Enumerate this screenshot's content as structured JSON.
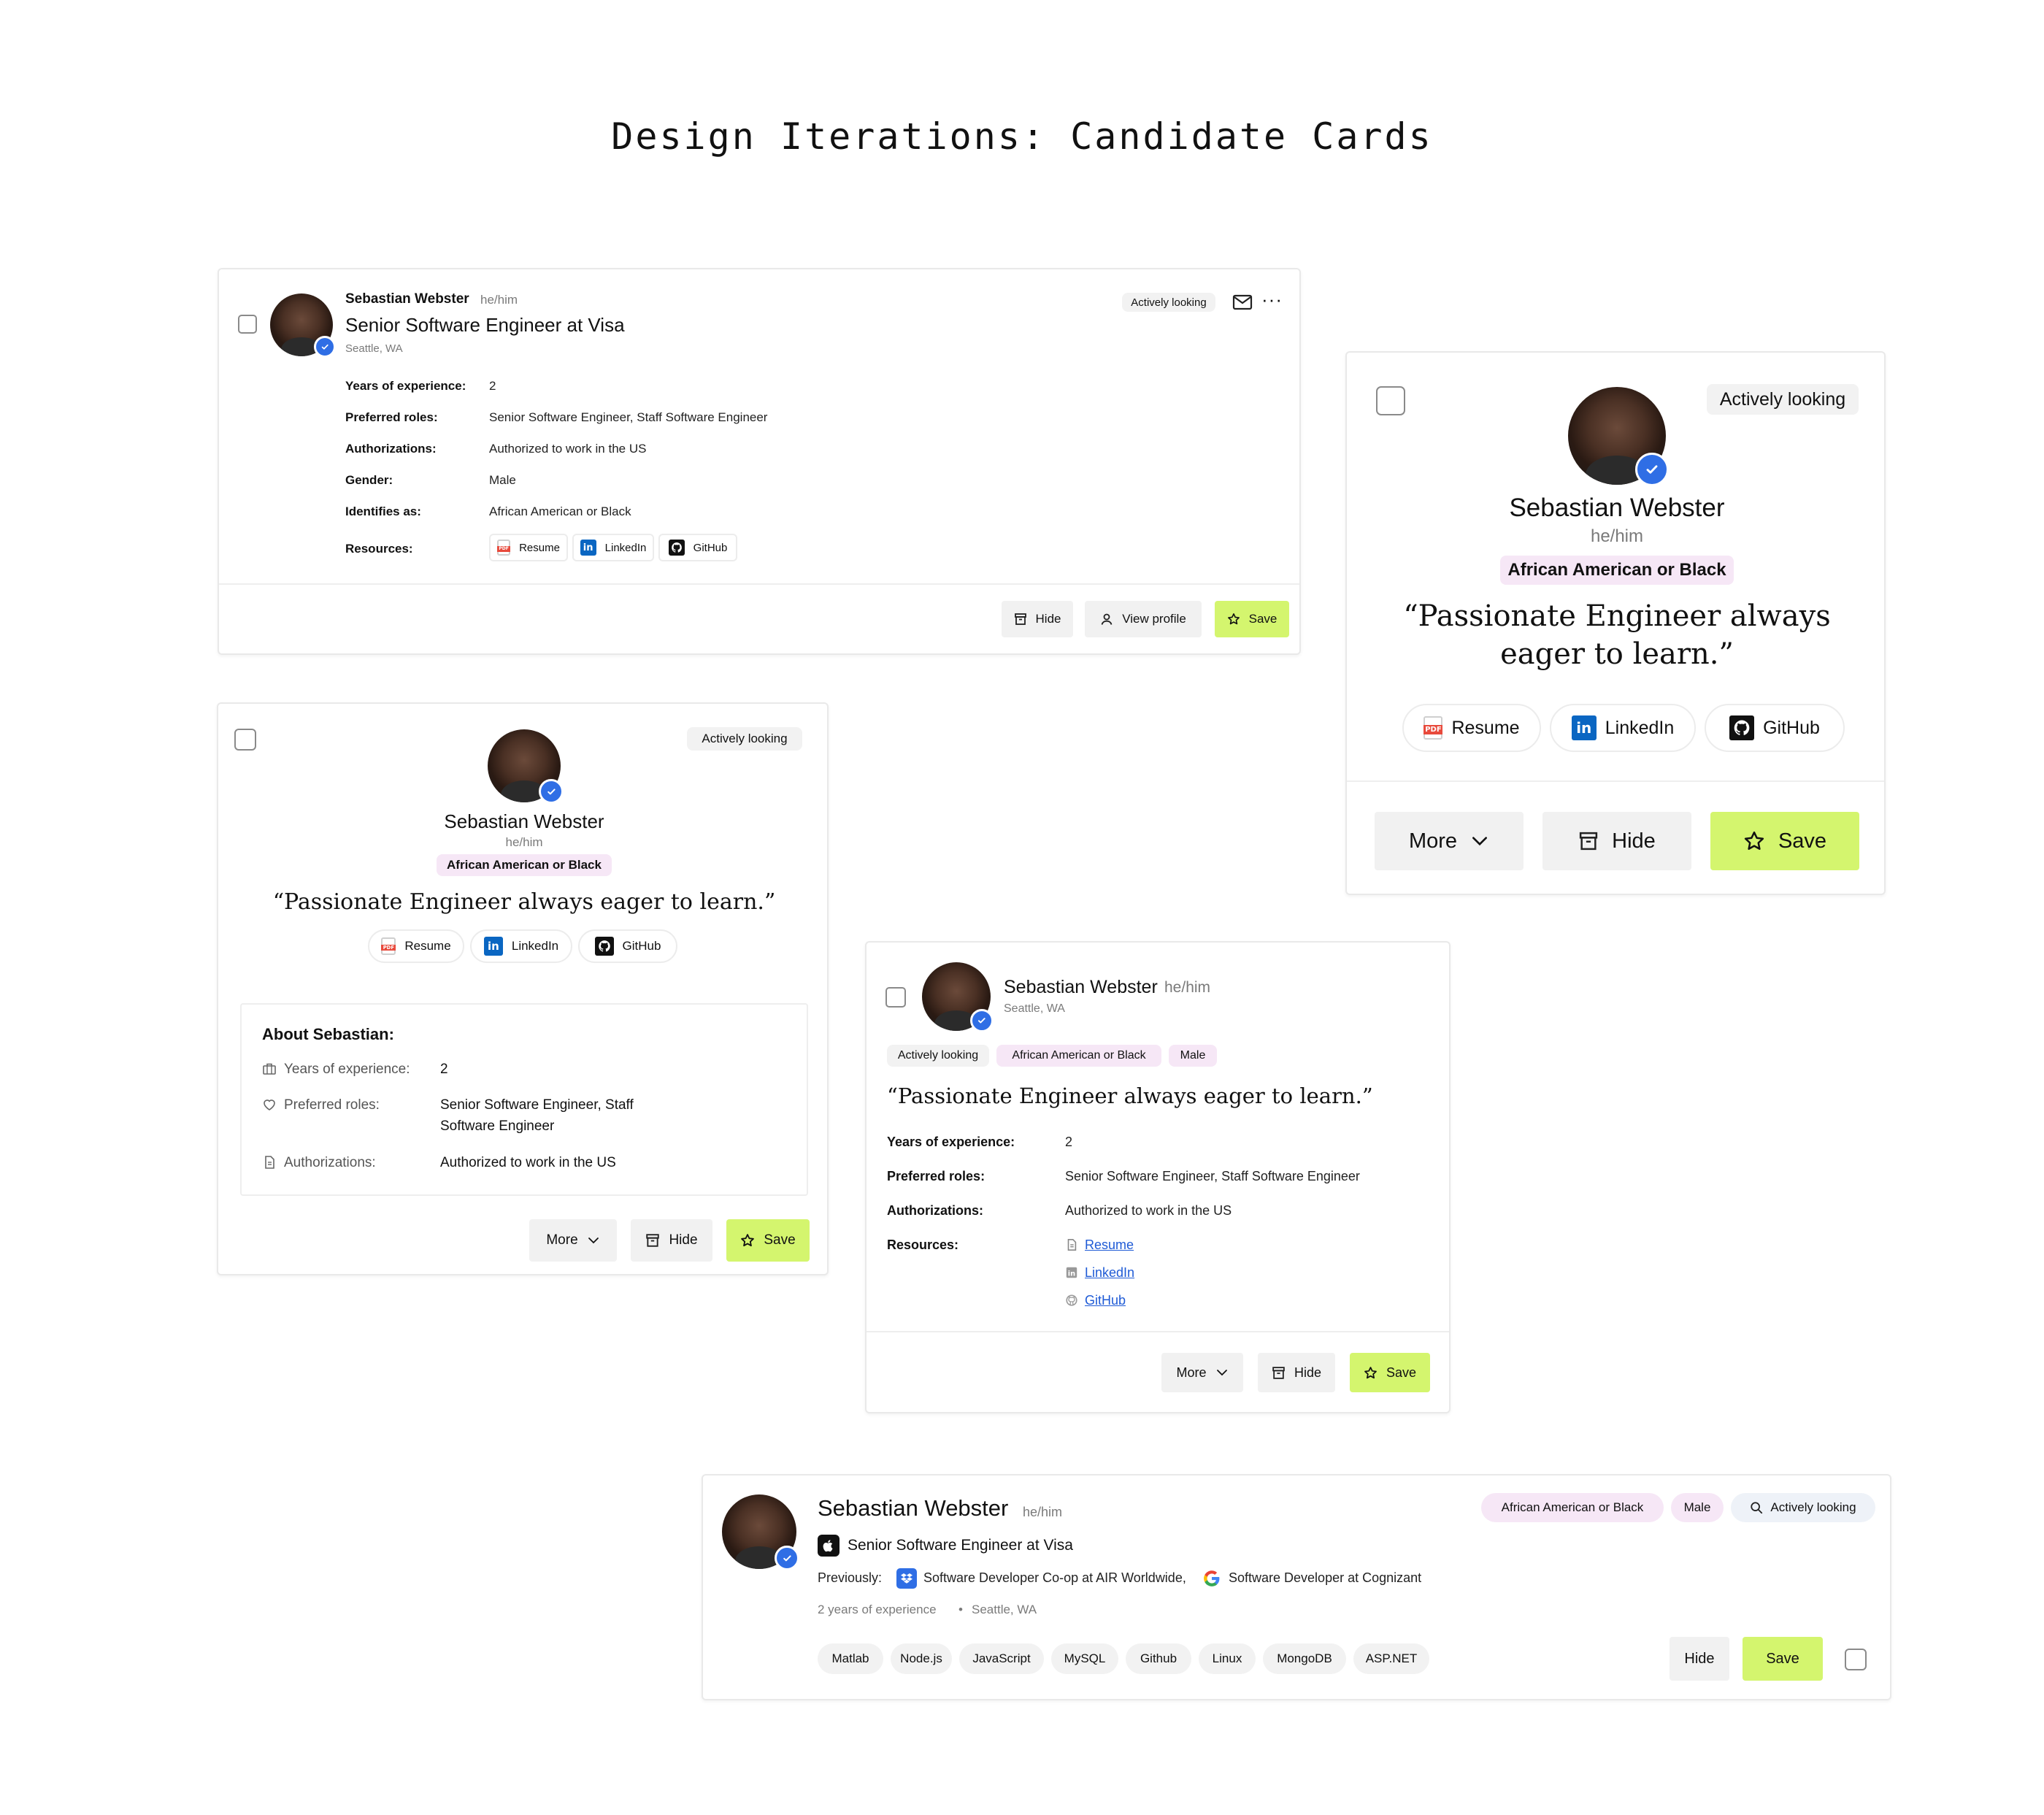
{
  "page_title": "Design Iterations: Candidate Cards",
  "candidate": {
    "name": "Sebastian Webster",
    "pronouns": "he/him",
    "title": "Senior Software Engineer at Visa",
    "location": "Seattle, WA",
    "status": "Actively looking",
    "ethnicity": "African American or Black",
    "gender": "Male",
    "quote": "“Passionate Engineer always eager to learn.”",
    "quote_line1": "“Passionate Engineer always",
    "quote_line2": "eager to learn.”"
  },
  "labels": {
    "years_experience": "Years of experience:",
    "preferred_roles": "Preferred roles:",
    "authorizations": "Authorizations:",
    "gender": "Gender:",
    "identifies_as": "Identifies as:",
    "resources": "Resources:",
    "about": "About Sebastian:",
    "previously": "Previously:"
  },
  "values": {
    "years": "2",
    "roles": "Senior Software Engineer, Staff Software Engineer",
    "roles_line1": "Senior Software Engineer, Staff",
    "roles_line2": "Software Engineer",
    "authorization": "Authorized to work in the US",
    "gender": "Male",
    "identifies": "African American or Black"
  },
  "resources": {
    "resume": "Resume",
    "linkedin": "LinkedIn",
    "github": "GitHub"
  },
  "buttons": {
    "hide": "Hide",
    "view_profile": "View profile",
    "save": "Save",
    "more": "More"
  },
  "card5": {
    "previous_1": "Software Developer Co-op at AIR Worldwide,",
    "previous_2": "Software Developer at Cognizant",
    "meta_experience": "2 years of experience",
    "meta_sep": "•",
    "skills": [
      "Matlab",
      "Node.js",
      "JavaScript",
      "MySQL",
      "Github",
      "Linux",
      "MongoDB",
      "ASP.NET"
    ]
  },
  "colors": {
    "save": "#d4f56e",
    "verify": "#2f6ee5",
    "pink_tag": "#f6e7f6",
    "link": "#1f5bd6"
  }
}
